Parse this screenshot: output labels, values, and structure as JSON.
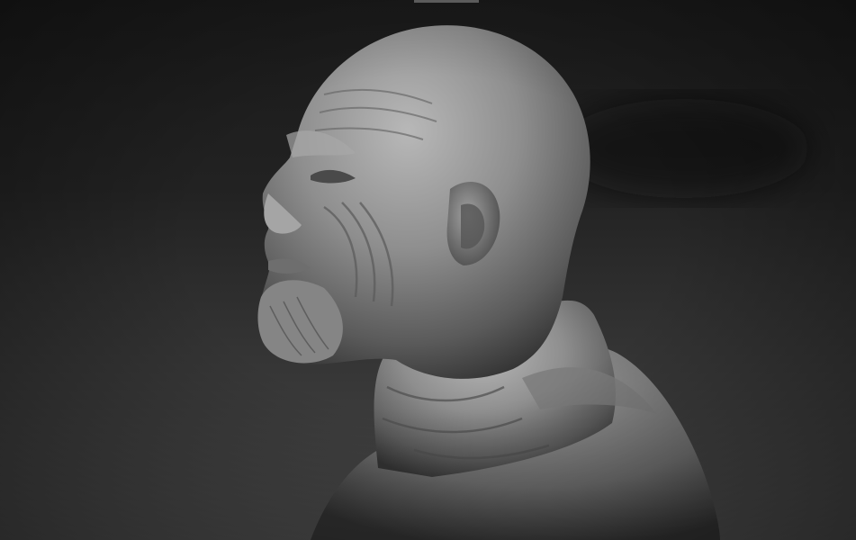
{
  "scene": {
    "subject": "clay-sculpt-bust",
    "material_color": "#8f8f8f",
    "background_top": "#1a1a1a",
    "background_bottom": "#4a4a4a"
  }
}
